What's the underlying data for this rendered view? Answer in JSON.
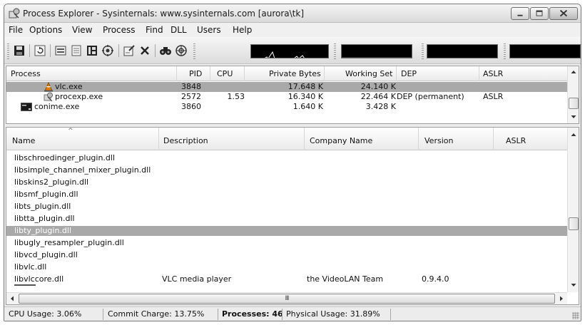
{
  "window": {
    "title": "Process Explorer - Sysinternals: www.sysinternals.com [aurora\\tk]",
    "icon": "process-explorer-icon"
  },
  "menu": [
    "File",
    "Options",
    "View",
    "Process",
    "Find",
    "DLL",
    "Users",
    "Help"
  ],
  "toolbar": {
    "buttons": [
      "save-icon",
      "refresh-icon",
      "system-info-icon",
      "properties-window-icon",
      "tree-view-icon",
      "target-icon",
      "properties-icon",
      "kill-process-icon",
      "find-icon",
      "find-window-icon"
    ],
    "graphs": [
      "cpu-graph",
      "commit-graph",
      "io-graph",
      "physical-memory-graph"
    ]
  },
  "process_table": {
    "columns": [
      "Process",
      "PID",
      "CPU",
      "Private Bytes",
      "Working Set",
      "DEP",
      "ASLR"
    ],
    "rows": [
      {
        "name": "vlc.exe",
        "pid": "3848",
        "cpu": "",
        "private_bytes": "17.648 K",
        "working_set": "24.140 K",
        "dep": "",
        "aslr": "",
        "selected": true,
        "icon": "vlc-cone-icon"
      },
      {
        "name": "procexp.exe",
        "pid": "2572",
        "cpu": "1.53",
        "private_bytes": "16.340 K",
        "working_set": "22.464 K",
        "dep": "DEP (permanent)",
        "aslr": "ASLR",
        "selected": false,
        "icon": "procexp-icon"
      },
      {
        "name": "conime.exe",
        "pid": "3860",
        "cpu": "",
        "private_bytes": "1.640 K",
        "working_set": "3.428 K",
        "dep": "",
        "aslr": "",
        "selected": false,
        "icon": "console-icon"
      }
    ]
  },
  "dll_table": {
    "columns": [
      "Name",
      "Description",
      "Company Name",
      "Version",
      "ASLR"
    ],
    "sort_indicator": "^",
    "rows": [
      {
        "name": "libschroedinger_plugin.dll",
        "description": "",
        "company": "",
        "version": "",
        "aslr": ""
      },
      {
        "name": "libsimple_channel_mixer_plugin.dll",
        "description": "",
        "company": "",
        "version": "",
        "aslr": ""
      },
      {
        "name": "libskins2_plugin.dll",
        "description": "",
        "company": "",
        "version": "",
        "aslr": ""
      },
      {
        "name": "libsmf_plugin.dll",
        "description": "",
        "company": "",
        "version": "",
        "aslr": ""
      },
      {
        "name": "libts_plugin.dll",
        "description": "",
        "company": "",
        "version": "",
        "aslr": ""
      },
      {
        "name": "libtta_plugin.dll",
        "description": "",
        "company": "",
        "version": "",
        "aslr": ""
      },
      {
        "name": "libty_plugin.dll",
        "description": "",
        "company": "",
        "version": "",
        "aslr": "",
        "selected": true
      },
      {
        "name": "libugly_resampler_plugin.dll",
        "description": "",
        "company": "",
        "version": "",
        "aslr": ""
      },
      {
        "name": "libvcd_plugin.dll",
        "description": "",
        "company": "",
        "version": "",
        "aslr": ""
      },
      {
        "name": "libvlc.dll",
        "description": "",
        "company": "",
        "version": "",
        "aslr": ""
      },
      {
        "name": "libvlccore.dll",
        "description": "VLC media player",
        "company": "the VideoLAN Team",
        "version": "0.9.4.0",
        "aslr": ""
      }
    ],
    "scroll_grip": "III"
  },
  "status": {
    "cpu_usage": "CPU Usage: 3.06%",
    "commit_charge": "Commit Charge: 13.75%",
    "processes": "Processes: 46",
    "physical_usage": "Physical Usage: 31.89%"
  },
  "colors": {
    "selection": "#a9a9a9",
    "graph_bg": "#000000",
    "graph_line": "#ffffff"
  }
}
